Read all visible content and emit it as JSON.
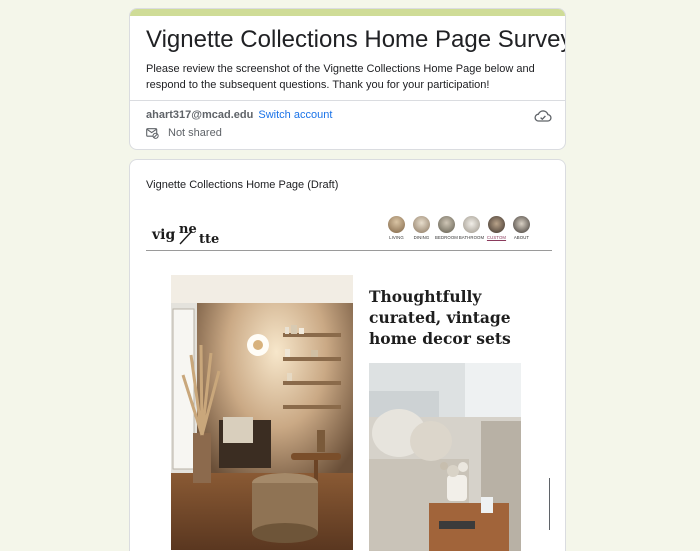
{
  "header": {
    "title": "Vignette Collections Home Page Survey",
    "description": "Please review the screenshot of the Vignette Collections Home Page below and respond to the subsequent questions. Thank you for your participation!",
    "account_email": "ahart317@mcad.edu",
    "switch_account_label": "Switch account",
    "shared_status": "Not shared",
    "accent_color": "#cfdc97"
  },
  "question": {
    "title": "Vignette Collections Home Page (Draft)"
  },
  "screenshot": {
    "nav_items": [
      "LIVING",
      "DINING",
      "BEDROOM",
      "BATHROOM",
      "CUSTOM",
      "ABOUT"
    ],
    "active_nav": "CUSTOM",
    "headline": "Thoughtfully curated, vintage home decor sets"
  },
  "background_color": "#f4f6ea"
}
